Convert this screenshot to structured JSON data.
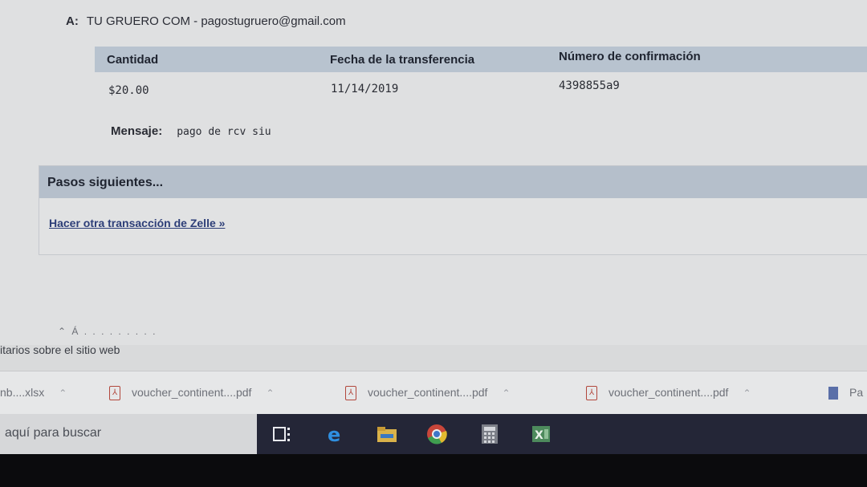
{
  "recipient": {
    "label": "A:",
    "value": "TU GRUERO COM - pagostugruero@gmail.com"
  },
  "summary": {
    "headers": [
      "Cantidad",
      "Fecha de la transferencia",
      "Número de confirmación"
    ],
    "values": [
      "$20.00",
      "11/14/2019",
      "4398855a9"
    ]
  },
  "message": {
    "label": "Mensaje:",
    "value": "pago de rcv siu"
  },
  "next_steps": {
    "title": "Pasos siguientes...",
    "link": "Hacer otra transacción de Zelle »"
  },
  "footer": {
    "feedback": "itarios sobre el sitio web"
  },
  "downloads": [
    {
      "name": "nb....xlsx"
    },
    {
      "name": "voucher_continent....pdf"
    },
    {
      "name": "voucher_continent....pdf"
    },
    {
      "name": "voucher_continent....pdf"
    },
    {
      "name": "Pa"
    }
  ],
  "taskbar": {
    "search_text": "aquí para buscar",
    "icons": [
      "task-view-icon",
      "edge-icon",
      "file-explorer-icon",
      "chrome-icon",
      "calculator-icon",
      "excel-icon"
    ]
  },
  "colors": {
    "header_bg": "#b8c3cf",
    "link": "#2d3e78",
    "taskbar": "#242637"
  }
}
